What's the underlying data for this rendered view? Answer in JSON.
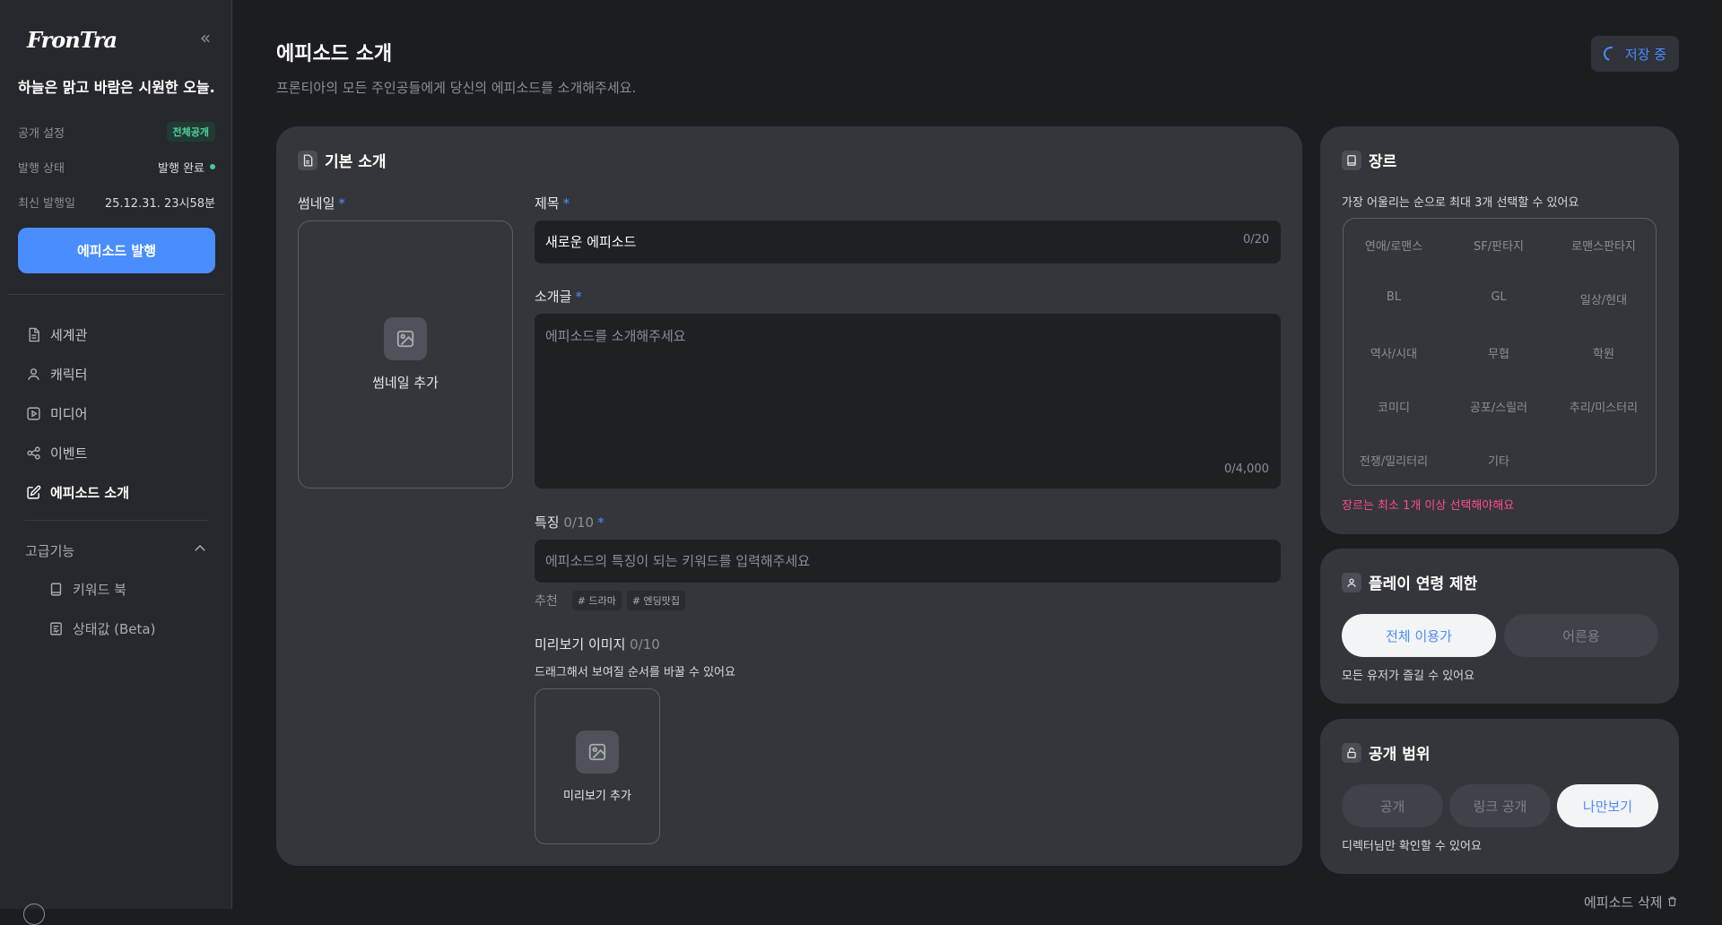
{
  "sidebar": {
    "logo": "FronTra",
    "project_title": "하늘은 맑고 바람은 시원한 오늘...",
    "meta": {
      "visibility_label": "공개 설정",
      "visibility_value": "전체공개",
      "publish_status_label": "발행 상태",
      "publish_status_value": "발행 완료",
      "last_published_label": "최신 발행일",
      "last_published_value": "25.12.31. 23시58분"
    },
    "publish_button": "에피소드 발행",
    "nav": [
      {
        "label": "세계관",
        "icon": "document-icon"
      },
      {
        "label": "캐릭터",
        "icon": "person-icon"
      },
      {
        "label": "미디어",
        "icon": "play-icon"
      },
      {
        "label": "이벤트",
        "icon": "share-nodes-icon"
      },
      {
        "label": "에피소드 소개",
        "icon": "edit-icon",
        "active": true
      }
    ],
    "advanced": {
      "label": "고급기능",
      "items": [
        {
          "label": "키워드 북",
          "icon": "book-icon"
        },
        {
          "label": "상태값 (Beta)",
          "icon": "status-icon"
        }
      ]
    }
  },
  "header": {
    "title": "에피소드 소개",
    "subtitle": "프론티아의 모든 주인공들에게 당신의 에피소드를 소개해주세요.",
    "saving_label": "저장 중"
  },
  "basic": {
    "title": "기본 소개",
    "thumbnail_label": "썸네일",
    "thumbnail_add": "썸네일 추가",
    "title_label": "제목",
    "title_value": "새로운 에피소드",
    "title_counter": "0/20",
    "intro_label": "소개글",
    "intro_placeholder": "에피소드를 소개해주세요",
    "intro_counter": "0/4,000",
    "features_label": "특징",
    "features_count": "0/10",
    "features_placeholder": "에피소드의 특징이 되는 키워드를 입력해주세요",
    "recommend_label": "추천",
    "recommend_tags": [
      "# 드라마",
      "# 엔딩맛집"
    ],
    "preview_label": "미리보기 이미지",
    "preview_count": "0/10",
    "preview_hint": "드래그해서 보여질 순서를 바꿀 수 있어요",
    "preview_add": "미리보기 추가"
  },
  "genre": {
    "title": "장르",
    "hint": "가장 어울리는 순으로 최대 3개 선택할 수 있어요",
    "items": [
      "연애/로맨스",
      "SF/판타지",
      "로맨스판타지",
      "BL",
      "GL",
      "일상/현대",
      "역사/시대",
      "무협",
      "학원",
      "코미디",
      "공포/스릴러",
      "추리/미스터리",
      "전쟁/밀리터리",
      "기타"
    ],
    "error": "장르는 최소 1개 이상 선택해야해요"
  },
  "age": {
    "title": "플레이 연령 제한",
    "options": [
      "전체 이용가",
      "어른용"
    ],
    "selected": "전체 이용가",
    "helper": "모든 유저가 즐길 수 있어요"
  },
  "scope": {
    "title": "공개 범위",
    "options": [
      "공개",
      "링크 공개",
      "나만보기"
    ],
    "selected": "나만보기",
    "helper": "디렉터님만 확인할 수 있어요"
  },
  "delete_label": "에피소드 삭제",
  "colors": {
    "accent": "#4a8dff",
    "error": "#ff4d8d",
    "badge_green": "#4fd1a5",
    "background": "#1c1d21",
    "card": "#34363c"
  }
}
